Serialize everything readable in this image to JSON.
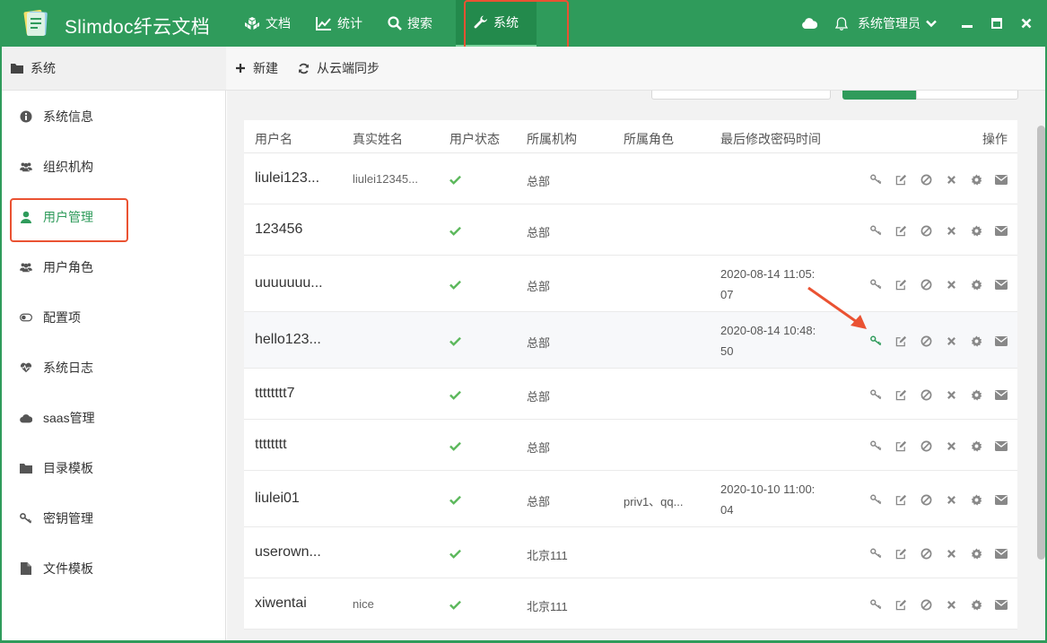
{
  "app": {
    "title": "Slimdoc纤云文档"
  },
  "nav": [
    {
      "label": "文档",
      "icon": "cubes-icon"
    },
    {
      "label": "统计",
      "icon": "line-chart-icon"
    },
    {
      "label": "搜索",
      "icon": "search-icon"
    },
    {
      "label": "系统",
      "icon": "wrench-icon",
      "active": true
    }
  ],
  "header": {
    "user": "系统管理员"
  },
  "section": {
    "title": "系统"
  },
  "toolbar": {
    "new_label": "新建",
    "sync_label": "从云端同步"
  },
  "sidebar": {
    "items": [
      {
        "label": "系统信息",
        "icon": "info-circle-icon"
      },
      {
        "label": "组织机构",
        "icon": "users-icon"
      },
      {
        "label": "用户管理",
        "icon": "user-icon",
        "active": true
      },
      {
        "label": "用户角色",
        "icon": "users-icon"
      },
      {
        "label": "配置项",
        "icon": "toggle-icon"
      },
      {
        "label": "系统日志",
        "icon": "heartbeat-icon"
      },
      {
        "label": "saas管理",
        "icon": "cloud-icon"
      },
      {
        "label": "目录模板",
        "icon": "folder-icon"
      },
      {
        "label": "密钥管理",
        "icon": "key-icon"
      },
      {
        "label": "文件模板",
        "icon": "file-icon"
      }
    ]
  },
  "table": {
    "headers": [
      "用户名",
      "真实姓名",
      "用户状态",
      "所属机构",
      "所属角色",
      "最后修改密码时间",
      "操作"
    ],
    "rows": [
      {
        "name": "liulei123...",
        "real": "liulei12345...",
        "org": "总部",
        "role": "",
        "pwd1": "",
        "pwd2": ""
      },
      {
        "name": "123456",
        "real": "",
        "org": "总部",
        "role": "",
        "pwd1": "",
        "pwd2": ""
      },
      {
        "name": "uuuuuuu...",
        "real": "",
        "org": "总部",
        "role": "",
        "pwd1": "2020-08-14 11:05:",
        "pwd2": "07"
      },
      {
        "name": "hello123...",
        "real": "",
        "org": "总部",
        "role": "",
        "pwd1": "2020-08-14 10:48:",
        "pwd2": "50"
      },
      {
        "name": "tttttttt7",
        "real": "",
        "org": "总部",
        "role": "",
        "pwd1": "",
        "pwd2": ""
      },
      {
        "name": "tttttttt",
        "real": "",
        "org": "总部",
        "role": "",
        "pwd1": "",
        "pwd2": ""
      },
      {
        "name": "liulei01",
        "real": "",
        "org": "总部",
        "role": "priv1、qq...",
        "pwd1": "2020-10-10 11:00:",
        "pwd2": "04"
      },
      {
        "name": "userown...",
        "real": "",
        "org": "北京111",
        "role": "",
        "pwd1": "",
        "pwd2": ""
      },
      {
        "name": "xiwentai",
        "real": "nice",
        "org": "北京111",
        "role": "",
        "pwd1": "",
        "pwd2": ""
      }
    ]
  },
  "colors": {
    "brand": "#2f9b5b",
    "highlight": "#ea5232",
    "check": "#5cb85c"
  }
}
